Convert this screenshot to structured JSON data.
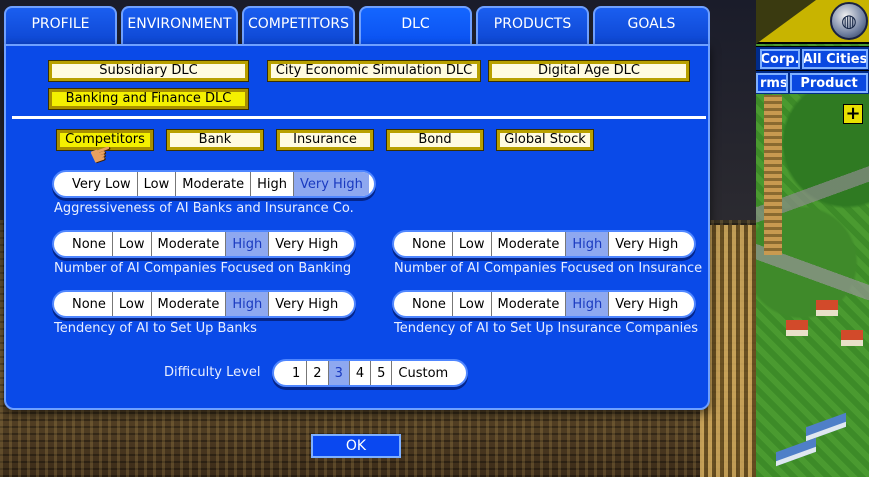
{
  "tabs": [
    {
      "label": "PROFILE",
      "active": false
    },
    {
      "label": "ENVIRONMENT",
      "active": false
    },
    {
      "label": "COMPETITORS",
      "active": false
    },
    {
      "label": "DLC",
      "active": true
    },
    {
      "label": "PRODUCTS",
      "active": false
    },
    {
      "label": "GOALS",
      "active": false
    }
  ],
  "dlc_buttons": [
    {
      "label": "Subsidiary DLC",
      "selected": false
    },
    {
      "label": "City Economic Simulation DLC",
      "selected": false
    },
    {
      "label": "Digital Age DLC",
      "selected": false
    },
    {
      "label": "Banking and Finance DLC",
      "selected": true
    }
  ],
  "sub_tabs": [
    {
      "label": "Competitors",
      "selected": true
    },
    {
      "label": "Bank",
      "selected": false
    },
    {
      "label": "Insurance",
      "selected": false
    },
    {
      "label": "Bond",
      "selected": false
    },
    {
      "label": "Global Stock",
      "selected": false
    }
  ],
  "settings": {
    "aggressiveness": {
      "options": [
        "Very Low",
        "Low",
        "Moderate",
        "High",
        "Very High"
      ],
      "selected": "Very High",
      "caption": "Aggressiveness of AI Banks and Insurance Co."
    },
    "ai_banking": {
      "options": [
        "None",
        "Low",
        "Moderate",
        "High",
        "Very High"
      ],
      "selected": "High",
      "caption": "Number of AI Companies Focused on Banking"
    },
    "ai_insurance": {
      "options": [
        "None",
        "Low",
        "Moderate",
        "High",
        "Very High"
      ],
      "selected": "High",
      "caption": "Number of AI Companies Focused on Insurance"
    },
    "bank_setup": {
      "options": [
        "None",
        "Low",
        "Moderate",
        "High",
        "Very High"
      ],
      "selected": "High",
      "caption": "Tendency of AI to Set Up Banks"
    },
    "insurance_setup": {
      "options": [
        "None",
        "Low",
        "Moderate",
        "High",
        "Very High"
      ],
      "selected": "High",
      "caption": "Tendency of AI to Set Up Insurance Companies"
    }
  },
  "difficulty": {
    "label": "Difficulty Level",
    "options": [
      "1",
      "2",
      "3",
      "4",
      "5",
      "Custom"
    ],
    "selected": "3"
  },
  "ok_label": "OK",
  "hud": {
    "corp_label": "Corp.",
    "all_cities_label": "All Cities",
    "firms_label": "rms",
    "product_label": "Product",
    "plus_label": "+"
  },
  "colors": {
    "panel_blue": "#0a4ae8",
    "selected_option": "#8ea8f0",
    "yellow_selected": "#f4f000"
  }
}
